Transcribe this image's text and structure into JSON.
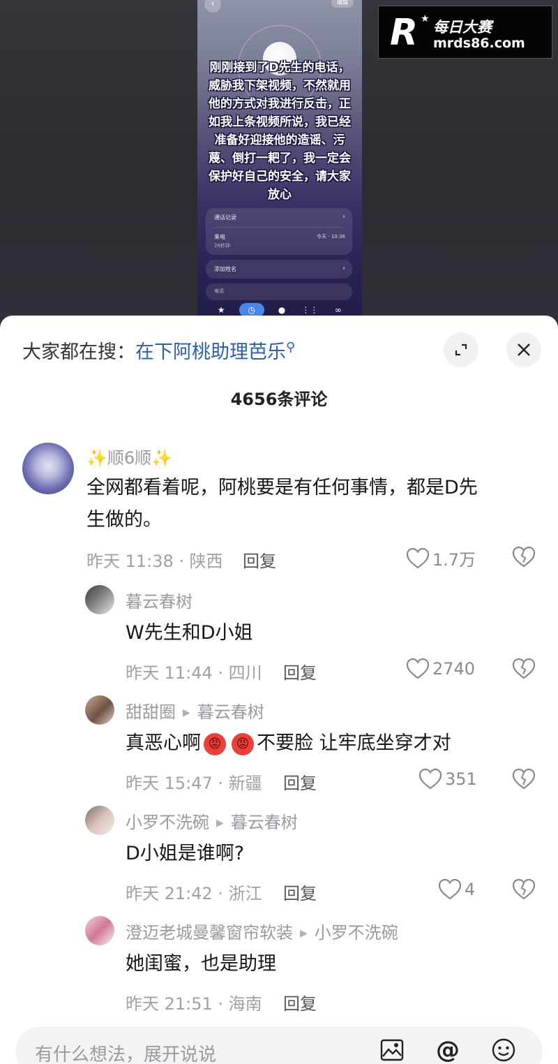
{
  "video": {
    "back_icon": "chevron-left-icon",
    "edit_label": "编辑",
    "overlay_text": "刚刚接到了D先生的电话，威胁我下架视频，不然就用他的方式对我进行反击，正如我上条视频所说，我已经准备好迎接他的造谣、污蔑、倒打一耙了，我一定会保护好自己的安全，请大家放心",
    "call_card": {
      "records_label": "通话记录",
      "incoming_label": "来电",
      "duration": "26秒钟",
      "time": "今天 · 10:36"
    },
    "add_name_label": "添加姓名",
    "phone_label": "电话"
  },
  "watermark": {
    "logo_letter": "R",
    "cn": "每日大赛",
    "url": "mrds86.com"
  },
  "sheet": {
    "search_prefix": "大家都在搜：",
    "search_keyword": "在下阿桃助理芭乐",
    "comment_count": "4656条评论",
    "comments": [
      {
        "user": "✨顺6顺✨",
        "text_line1": "全网都看着呢，阿桃要是有任何事情，都是D先",
        "text_line2": "生做的。",
        "meta": "昨天 11:38 · 陕西",
        "reply_label": "回复",
        "likes": "1.7万"
      },
      {
        "user": "暮云春树",
        "text": "W先生和D小姐",
        "meta": "昨天 11:44 · 四川",
        "reply_label": "回复",
        "likes": "2740"
      },
      {
        "user": "甜甜圈",
        "reply_to": "暮云春树",
        "text_a": "真恶心啊",
        "text_b": "不要脸 让牢底坐穿才对",
        "meta": "昨天 15:47 · 新疆",
        "reply_label": "回复",
        "likes": "351"
      },
      {
        "user": "小罗不洗碗",
        "reply_to": "暮云春树",
        "text": "D小姐是谁啊?",
        "meta": "昨天 21:42 · 浙江",
        "reply_label": "回复",
        "likes": "4"
      },
      {
        "user": "澄迈老城曼馨窗帘软装",
        "reply_to": "小罗不洗碗",
        "text": "她闺蜜，也是助理",
        "meta": "昨天 21:51 · 海南",
        "reply_label": "回复"
      }
    ],
    "input_placeholder": "有什么想法，展开说说"
  }
}
